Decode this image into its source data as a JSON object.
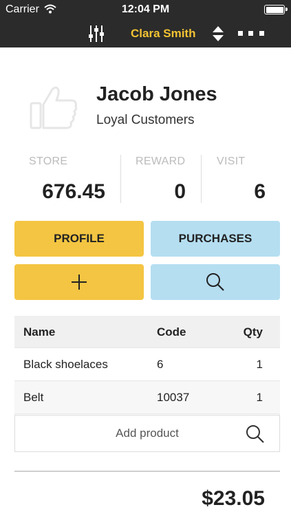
{
  "status_bar": {
    "carrier": "Carrier",
    "time": "12:04 PM"
  },
  "nav": {
    "user": "Clara Smith",
    "icons": [
      "sliders-icon",
      "sort-arrows-icon",
      "more-dots-icon"
    ]
  },
  "customer": {
    "name": "Jacob Jones",
    "group": "Loyal Customers",
    "avatar_icon": "thumbs-up-icon"
  },
  "stats": [
    {
      "label": "STORE",
      "value": "676.45"
    },
    {
      "label": "REWARD",
      "value": "0"
    },
    {
      "label": "VISIT",
      "value": "6"
    }
  ],
  "buttons": {
    "profile": "PROFILE",
    "purchases": "PURCHASES",
    "add_icon": "plus-icon",
    "search_icon": "search-icon"
  },
  "table": {
    "headers": [
      "Name",
      "Code",
      "Qty"
    ],
    "rows": [
      [
        "Black shoelaces",
        "6",
        "1"
      ],
      [
        "Belt",
        "10037",
        "1"
      ]
    ]
  },
  "add_product": {
    "placeholder": "Add product"
  },
  "total": "$23.05",
  "colors": {
    "bar": "#2b2b2b",
    "accent_yellow": "#f4c542",
    "accent_blue": "#b5def1",
    "nav_user": "#f3c332"
  }
}
